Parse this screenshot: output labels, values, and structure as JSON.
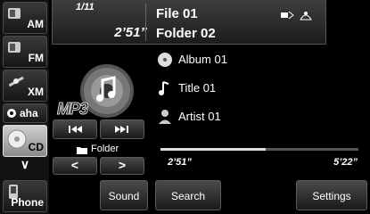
{
  "sources": [
    {
      "label": "AM",
      "icon": "radio-icon"
    },
    {
      "label": "FM",
      "icon": "radio-icon"
    },
    {
      "label": "XM",
      "icon": "satellite-icon"
    },
    {
      "label": "aha",
      "icon": "aha-icon"
    },
    {
      "label": "CD",
      "icon": "cd-icon",
      "active": true
    },
    {
      "label": "Phone",
      "icon": "phone-icon"
    }
  ],
  "header": {
    "track_number": "1/11",
    "elapsed": "2’51”",
    "file_name": "File 01",
    "folder_name": "Folder 02"
  },
  "media": {
    "format_badge": "MP3",
    "folder_label": "Folder"
  },
  "track_info": {
    "album": "Album 01",
    "title": "Title 01",
    "artist": "Artist 01"
  },
  "playback": {
    "elapsed": "2’51”",
    "duration": "5’22”",
    "progress_fraction": 0.53
  },
  "buttons": {
    "sound": "Sound",
    "search": "Search",
    "settings": "Settings"
  }
}
